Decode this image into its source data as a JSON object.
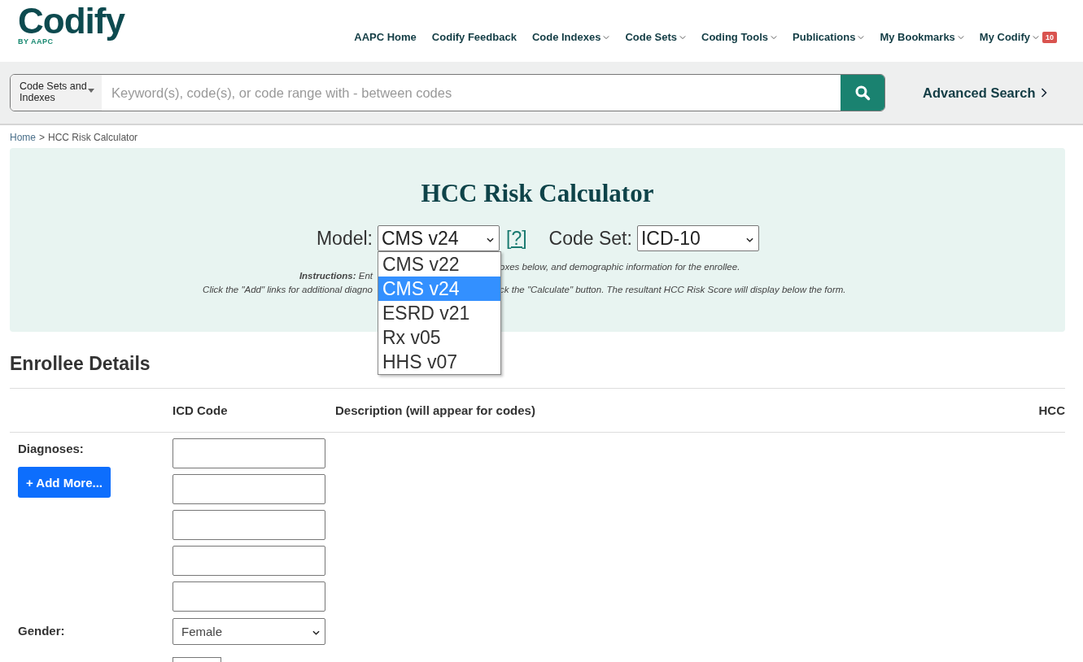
{
  "logo": {
    "name": "Codify",
    "tagline": "BY AAPC"
  },
  "nav": [
    {
      "label": "AAPC Home",
      "dropdown": false
    },
    {
      "label": "Codify Feedback",
      "dropdown": false
    },
    {
      "label": "Code Indexes",
      "dropdown": true
    },
    {
      "label": "Code Sets",
      "dropdown": true
    },
    {
      "label": "Coding Tools",
      "dropdown": true
    },
    {
      "label": "Publications",
      "dropdown": true
    },
    {
      "label": "My Bookmarks",
      "dropdown": true
    },
    {
      "label": "My Codify",
      "dropdown": true,
      "badge": "10"
    }
  ],
  "search": {
    "scope": "Code Sets and Indexes",
    "placeholder": "Keyword(s), code(s), or code range with - between codes",
    "advanced": "Advanced Search"
  },
  "breadcrumb": {
    "separator": ">",
    "items": [
      {
        "label": "Home",
        "link": true
      },
      {
        "label": "HCC Risk Calculator",
        "link": false
      }
    ]
  },
  "calculator": {
    "title": "HCC Risk Calculator",
    "model_label": "Model:",
    "model_value": "CMS v24",
    "help": "[?]",
    "code_set_label": "Code Set:",
    "code_set_value": "ICD-10",
    "model_options": [
      {
        "label": "CMS v22",
        "selected": false
      },
      {
        "label": "CMS v24",
        "selected": true
      },
      {
        "label": "ESRD v21",
        "selected": false
      },
      {
        "label": "Rx v05",
        "selected": false
      },
      {
        "label": "HHS v07",
        "selected": false
      }
    ],
    "instructions": [
      {
        "left": "**Instructions:** Ent",
        "right": "oxes below, and demographic information for the enrollee."
      },
      {
        "left": "Click the \"Add\" links for additional diagno",
        "right": "ck the \"Calculate\" button. The resultant HCC Risk Score will display below the form."
      }
    ]
  },
  "enrollee": {
    "heading": "Enrollee Details",
    "columns": [
      "ICD Code",
      "Description (will appear for codes)",
      "HCC"
    ],
    "diagnoses_label": "Diagnoses:",
    "add_button": "+ Add More...",
    "gender_label": "Gender:",
    "gender_value": "Female"
  }
}
